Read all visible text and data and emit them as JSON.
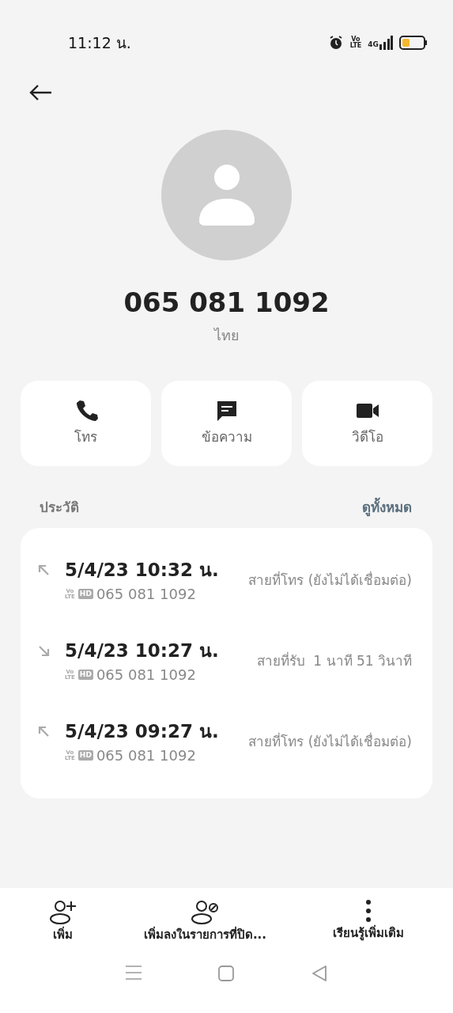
{
  "status_bar": {
    "time": "11:12 น.",
    "volte": [
      "Vo",
      "LTE"
    ],
    "network": "4G"
  },
  "contact": {
    "number": "065 081 1092",
    "location": "ไทย"
  },
  "actions": [
    {
      "kind": "call",
      "label": "โทร"
    },
    {
      "kind": "message",
      "label": "ข้อความ"
    },
    {
      "kind": "video",
      "label": "วิดีโอ"
    }
  ],
  "history": {
    "title": "ประวัติ",
    "see_all": "ดูทั้งหมด",
    "calls": [
      {
        "kind": "outgoing",
        "time": "5/4/23 10:32 น.",
        "volte": [
          "Vo",
          "LTE"
        ],
        "hd": "HD",
        "number": "065 081 1092",
        "status": "สายที่โทร (ยังไม่ได้เชื่อมต่อ)"
      },
      {
        "kind": "incoming",
        "time": "5/4/23 10:27 น.",
        "volte": [
          "Vo",
          "LTE"
        ],
        "hd": "HD",
        "number": "065 081 1092",
        "status": "สายที่รับ  1 นาที 51 วินาที"
      },
      {
        "kind": "outgoing",
        "time": "5/4/23 09:27 น.",
        "volte": [
          "Vo",
          "LTE"
        ],
        "hd": "HD",
        "number": "065 081 1092",
        "status": "สายที่โทร (ยังไม่ได้เชื่อมต่อ)"
      }
    ]
  },
  "bottom_actions": [
    {
      "kind": "add",
      "label": "เพิ่ม"
    },
    {
      "kind": "block",
      "label": "เพิ่มลงในรายการที่ปิด..."
    },
    {
      "kind": "more",
      "label": "เรียนรู้เพิ่มเติม"
    }
  ]
}
